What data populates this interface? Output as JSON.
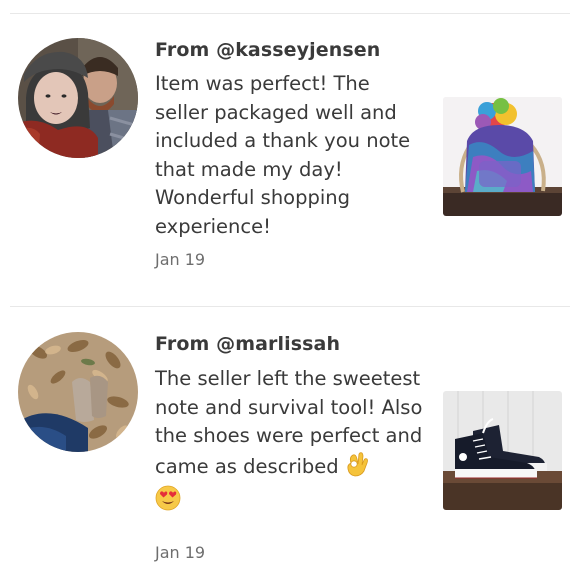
{
  "reviews": [
    {
      "author": "From @kasseyjensen",
      "text": "Item was perfect! The seller packaged well and included a thank you note that made my day! Wonderful shopping experience!",
      "date": "Jan 19",
      "avatar_icon": "user-photo-couple",
      "thumbnail_icon": "holographic-backpack-photo"
    },
    {
      "author": "From @marlissah",
      "text": "The seller left the sweetest note and survival tool! Also the shoes were perfect and came as described",
      "text_emoji_1": "ok-hand-emoji",
      "text_emoji_2": "heart-eyes-emoji",
      "date": "Jan 19",
      "avatar_icon": "user-photo-leaves",
      "thumbnail_icon": "high-top-sneakers-photo"
    }
  ]
}
